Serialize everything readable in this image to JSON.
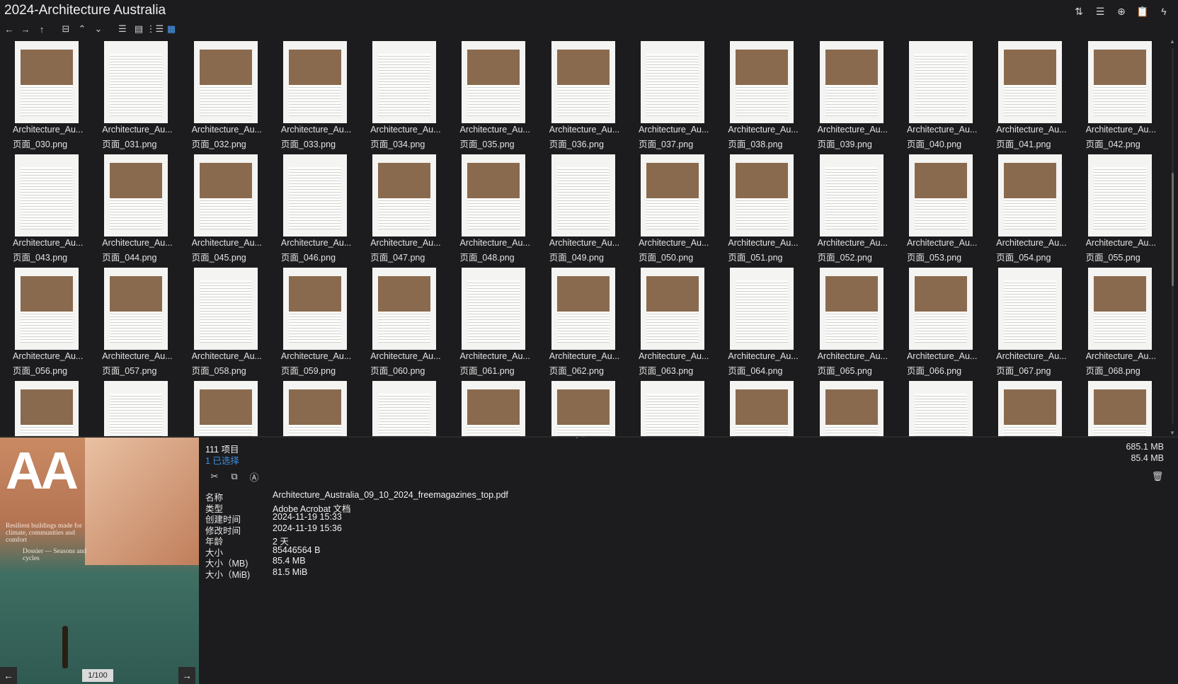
{
  "window": {
    "title": "2024-Architecture Australia"
  },
  "top_actions": [
    "sort-icon",
    "list-view-icon",
    "add-icon",
    "clipboard-icon",
    "flash-icon"
  ],
  "toolbar": {
    "buttons": [
      "back",
      "forward",
      "up",
      "folder",
      "collapse",
      "expand",
      "details-view",
      "tiles-view",
      "tree-view",
      "thumbnails-view"
    ],
    "icons": {
      "back": "←",
      "forward": "→",
      "up": "↑",
      "folder": "⊟",
      "collapse": "⌃",
      "expand": "⌄",
      "details": "☰",
      "tiles": "▤",
      "tree": "⋮☰",
      "thumbs": "▦"
    }
  },
  "files": {
    "name_prefix": "Architecture_Au...",
    "items": [
      "页面_030.png",
      "页面_031.png",
      "页面_032.png",
      "页面_033.png",
      "页面_034.png",
      "页面_035.png",
      "页面_036.png",
      "页面_037.png",
      "页面_038.png",
      "页面_039.png",
      "页面_040.png",
      "页面_041.png",
      "页面_042.png",
      "页面_043.png",
      "页面_044.png",
      "页面_045.png",
      "页面_046.png",
      "页面_047.png",
      "页面_048.png",
      "页面_049.png",
      "页面_050.png",
      "页面_051.png",
      "页面_052.png",
      "页面_053.png",
      "页面_054.png",
      "页面_055.png",
      "页面_056.png",
      "页面_057.png",
      "页面_058.png",
      "页面_059.png",
      "页面_060.png",
      "页面_061.png",
      "页面_062.png",
      "页面_063.png",
      "页面_064.png",
      "页面_065.png",
      "页面_066.png",
      "页面_067.png",
      "页面_068.png",
      "",
      "",
      "",
      "",
      "",
      "",
      "",
      "",
      "",
      "",
      "",
      "",
      ""
    ]
  },
  "preview": {
    "logo": "AA",
    "tagline": "Resilient buildings made for climate, communities and comfort",
    "dossier": "Dossier — Seasons and cycles",
    "page": "1/100"
  },
  "status": {
    "count": "111 项目",
    "selected": "1 已选择",
    "total_size": "685.1 MB",
    "selected_size": "85.4 MB"
  },
  "actions": {
    "cut": "✂",
    "copy": "⧉",
    "rename": "Ⓐ",
    "delete": "🗑"
  },
  "properties": [
    {
      "key": "名称",
      "value": "Architecture_Australia_09_10_2024_freemagazines_top.pdf"
    },
    {
      "key": "类型",
      "value": "Adobe Acrobat 文档"
    },
    {
      "key": "创建时间",
      "value": "2024-11-19  15:33"
    },
    {
      "key": "修改时间",
      "value": "2024-11-19  15:36"
    },
    {
      "key": "年龄",
      "value": "2 天"
    },
    {
      "key": "大小",
      "value": "85446564 B"
    },
    {
      "key": "大小（MB)",
      "value": "85.4 MB"
    },
    {
      "key": "大小（MiB)",
      "value": "81.5 MiB"
    }
  ]
}
